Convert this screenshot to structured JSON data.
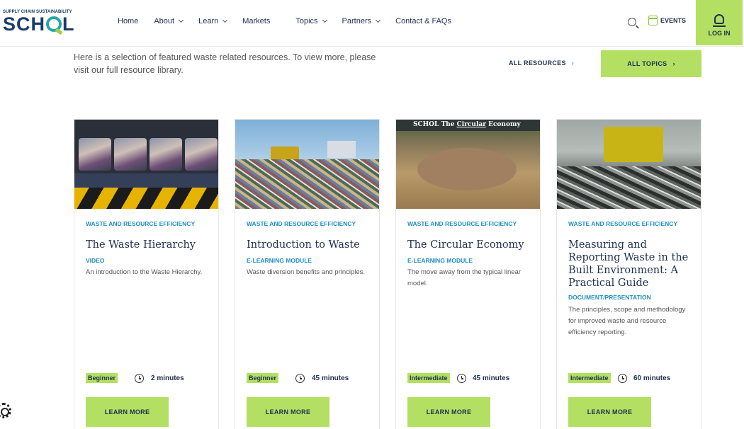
{
  "header": {
    "logo_tagline": "SUPPLY CHAIN SUSTAINABILITY",
    "logo_word_start": "SCH",
    "logo_word_end": "L",
    "nav": [
      {
        "label": "Home",
        "dropdown": false
      },
      {
        "label": "About",
        "dropdown": true
      },
      {
        "label": "Learn",
        "dropdown": true
      },
      {
        "label": "Markets",
        "dropdown": false
      },
      {
        "label": "Topics",
        "dropdown": true
      },
      {
        "label": "Partners",
        "dropdown": true
      },
      {
        "label": "Contact & FAQs",
        "dropdown": false
      }
    ],
    "events_label": "EVENTS",
    "login_label": "LOG IN"
  },
  "intro": {
    "text": "Here is a selection of featured waste related resources. To view more, please visit our full resource library.",
    "all_resources_label": "ALL RESOURCES",
    "all_topics_label": "ALL TOPICS",
    "arrow": "›"
  },
  "cards": [
    {
      "category": "WASTE AND RESOURCE EFFICIENCY",
      "title": "The Waste Hierarchy",
      "type": "VIDEO",
      "description": "An introduction to the Waste Hierarchy.",
      "level": "Beginner",
      "duration": "2 minutes",
      "button": "LEARN MORE"
    },
    {
      "category": "WASTE AND RESOURCE EFFICIENCY",
      "title": "Introduction to Waste",
      "type": "E-LEARNING MODULE",
      "description": "Waste diversion benefits and principles.",
      "level": "Beginner",
      "duration": "45 minutes",
      "button": "LEARN MORE"
    },
    {
      "category": "WASTE AND RESOURCE EFFICIENCY",
      "title": "The Circular Economy",
      "type": "E-LEARNING MODULE",
      "description": "The move away from the typical linear model.",
      "level": "Intermediate",
      "duration": "45 minutes",
      "button": "LEARN MORE",
      "image_caption_left": "SCH",
      "image_caption_o": "O",
      "image_caption_l": "L",
      "image_caption_the": "The",
      "image_caption_circular": "Circular",
      "image_caption_economy": "Economy"
    },
    {
      "category": "WASTE AND RESOURCE EFFICIENCY",
      "title": "Measuring and Reporting Waste in the Built Environment: A Practical Guide",
      "type": "DOCUMENT/PRESENTATION",
      "description": "The principles, scope and methodology for improved waste and resource efficiency reporting.",
      "level": "Intermediate",
      "duration": "60 minutes",
      "button": "LEARN MORE"
    }
  ],
  "colors": {
    "accent_green": "#b3e062",
    "link_blue": "#1f8fc2",
    "navy": "#1e3050"
  }
}
